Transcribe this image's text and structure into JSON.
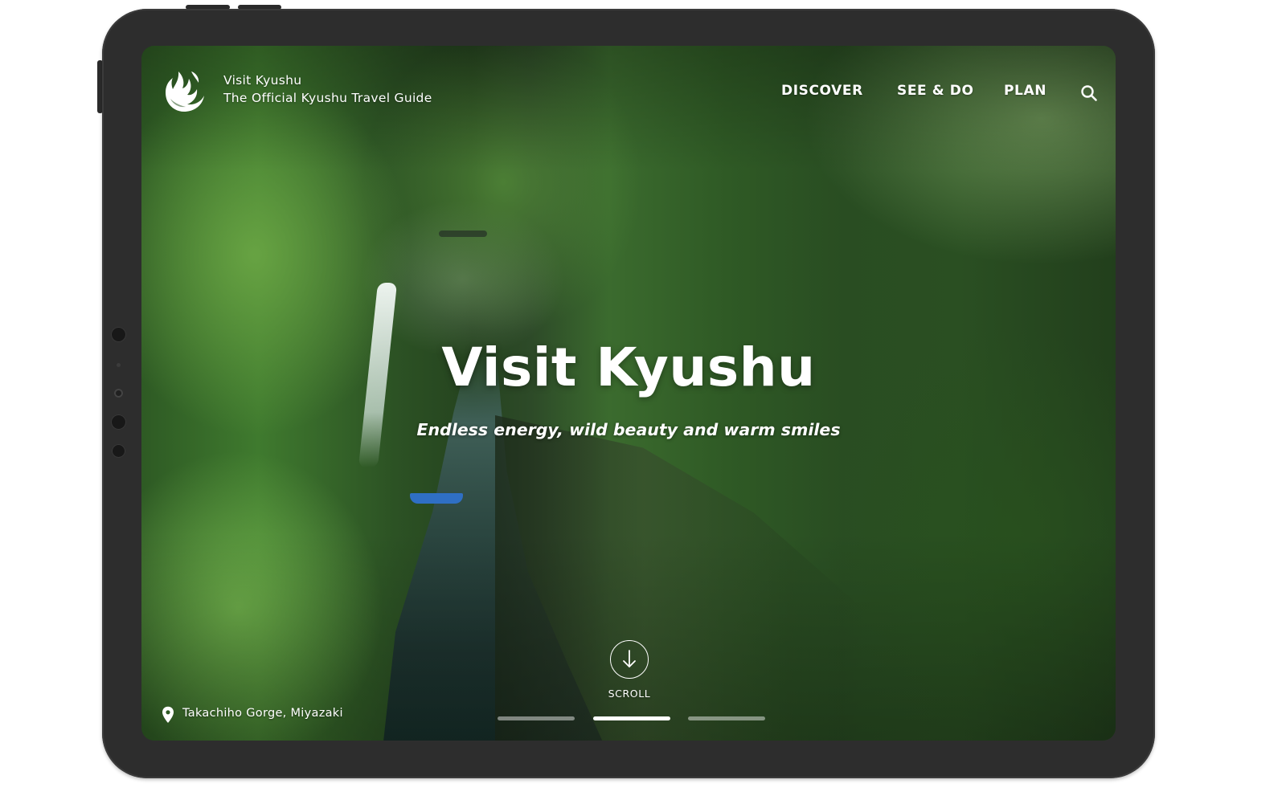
{
  "header": {
    "brand_name": "Visit Kyushu",
    "brand_tagline": "The Official Kyushu Travel Guide",
    "logo_icon": "kyushu-flame-logo",
    "nav": [
      {
        "label": "DISCOVER"
      },
      {
        "label": "SEE & DO"
      },
      {
        "label": "PLAN"
      }
    ],
    "search_icon": "search-icon"
  },
  "hero": {
    "title": "Visit Kyushu",
    "subtitle": "Endless energy, wild beauty and warm smiles",
    "scroll_label": "SCROLL",
    "scroll_icon": "arrow-down-icon"
  },
  "location": {
    "icon": "map-pin-icon",
    "text": "Takachiho Gorge, Miyazaki"
  },
  "slider": {
    "count": 3,
    "active_index": 1
  },
  "colors": {
    "text": "#ffffff",
    "device_frame": "#2d2d2d"
  }
}
